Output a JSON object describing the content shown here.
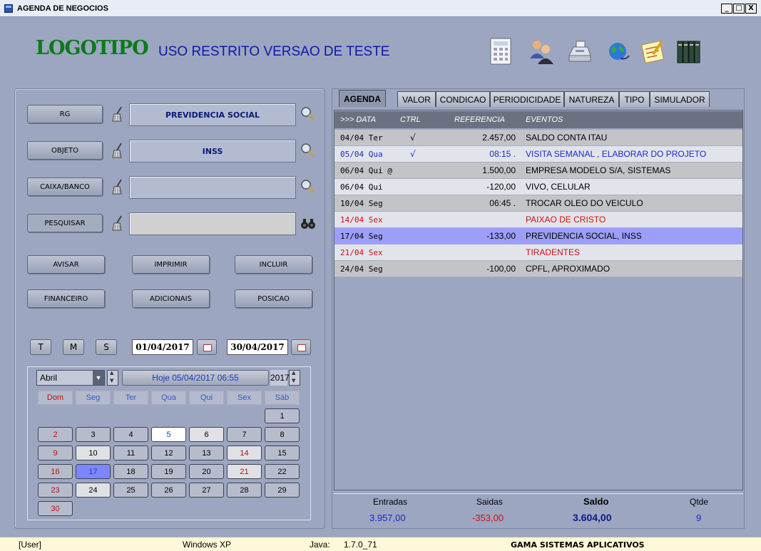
{
  "window": {
    "title": "AGENDA DE NEGOCIOS",
    "controls": [
      "_",
      "□",
      "X"
    ]
  },
  "header": {
    "logo": "LOGOTIPO",
    "subtitle": "USO RESTRITO VERSAO DE TESTE"
  },
  "toolbar_icons": [
    "calculator-icon",
    "users-icon",
    "cash-register-icon",
    "globe-icon",
    "notes-icon",
    "books-icon"
  ],
  "filters": {
    "rg": {
      "label": "RG",
      "value": "PREVIDENCIA SOCIAL"
    },
    "objeto": {
      "label": "OBJETO",
      "value": "INSS"
    },
    "caixa": {
      "label": "CAIXA/BANCO",
      "value": ""
    },
    "pesquisar": {
      "label": "PESQUISAR",
      "value": ""
    }
  },
  "actions": {
    "avisar": "AVISAR",
    "imprimir": "IMPRIMIR",
    "incluir": "INCLUIR",
    "financeiro": "FINANCEIRO",
    "adicionais": "ADICIONAIS",
    "posicao": "POSICAO"
  },
  "period": {
    "t": "T",
    "m": "M",
    "s": "S",
    "start": "01/04/2017",
    "end": "30/04/2017"
  },
  "calendar": {
    "month": "Abril",
    "today_label": "Hoje  05/04/2017  06:55",
    "year": "2017",
    "weekdays": [
      "Dom",
      "Seg",
      "Ter",
      "Qua",
      "Qui",
      "Sex",
      "Sáb"
    ],
    "days": [
      [
        "",
        "",
        "",
        "",
        "",
        "",
        "1"
      ],
      [
        "2",
        "3",
        "4",
        "5",
        "6",
        "7",
        "8"
      ],
      [
        "9",
        "10",
        "11",
        "12",
        "13",
        "14",
        "15"
      ],
      [
        "16",
        "17",
        "18",
        "19",
        "20",
        "21",
        "22"
      ],
      [
        "23",
        "24",
        "25",
        "26",
        "27",
        "28",
        "29"
      ],
      [
        "30",
        "",
        "",
        "",
        "",
        "",
        ""
      ]
    ]
  },
  "tabs": [
    "AGENDA",
    "VALOR",
    "CONDICAO",
    "PERIODICIDADE",
    "NATUREZA",
    "TIPO",
    "SIMULADOR"
  ],
  "grid": {
    "headers": {
      "date": ">>> DATA",
      "ctrl": "CTRL",
      "ref": "REFERENCIA",
      "events": "EVENTOS"
    },
    "rows": [
      {
        "date": "04/04 Ter",
        "ctrl": "√",
        "ref": "2.457,00",
        "event": "SALDO CONTA ITAU",
        "style": "gray"
      },
      {
        "date": "05/04 Qua",
        "ctrl": "√",
        "ref": "08:15        .",
        "event": "VISITA SEMANAL , ELABORAR DO PROJETO",
        "style": "light blue-text"
      },
      {
        "date": "06/04 Qui @",
        "ctrl": "",
        "ref": "1.500,00",
        "event": "EMPRESA MODELO S/A, SISTEMAS",
        "style": "gray"
      },
      {
        "date": "06/04 Qui",
        "ctrl": "",
        "ref": "-120,00",
        "event": "VIVO, CELULAR",
        "style": "light"
      },
      {
        "date": "10/04 Seg",
        "ctrl": "",
        "ref": "06:45        .",
        "event": "TROCAR OLEO DO VEICULO",
        "style": "gray"
      },
      {
        "date": "14/04 Sex",
        "ctrl": "",
        "ref": "",
        "event": "PAIXAO DE CRISTO",
        "style": "light red-text"
      },
      {
        "date": "17/04 Seg",
        "ctrl": "",
        "ref": "-133,00",
        "event": "PREVIDENCIA SOCIAL, INSS",
        "style": "selected"
      },
      {
        "date": "21/04 Sex",
        "ctrl": "",
        "ref": "",
        "event": "TIRADENTES",
        "style": "light red-text"
      },
      {
        "date": "24/04 Seg",
        "ctrl": "",
        "ref": "-100,00",
        "event": "CPFL, APROXIMADO",
        "style": "gray"
      }
    ]
  },
  "totals": {
    "entradas_label": "Entradas",
    "entradas": "3.957,00",
    "saidas_label": "Saidas",
    "saidas": "-353,00",
    "saldo_label": "Saldo",
    "saldo": "3.604,00",
    "qtde_label": "Qtde",
    "qtde": "9"
  },
  "status": {
    "user": "[User]",
    "os": "Windows XP",
    "java_label": "Java:",
    "java_version": "1.7.0_71",
    "company": "GAMA SISTEMAS APLICATIVOS"
  }
}
